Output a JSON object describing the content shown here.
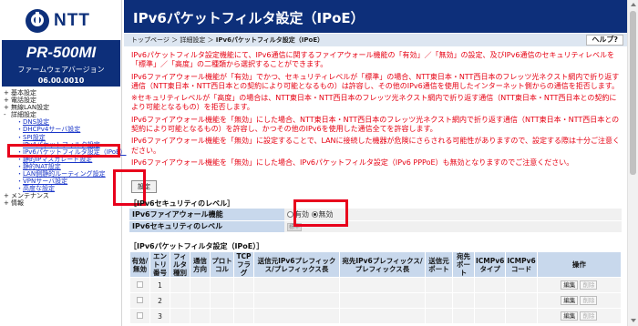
{
  "brand": {
    "logo_text": "NTT",
    "logo_icon": "ntt-globe-icon"
  },
  "model": {
    "name": "PR-500MI",
    "fw_label": "ファームウェアバージョン",
    "fw_version": "06.00.0010"
  },
  "nav": {
    "basic": "基本設定",
    "phone": "電話設定",
    "wlan": "無線LAN設定",
    "detail": "詳細設定",
    "dns": "DNS設定",
    "dhcpv4": "DHCPv4サーバ設定",
    "spi": "SPI設定",
    "ipv4_filter": "IPv4パケットフィルタ設定",
    "ipv6_filter": "IPv6パケットフィルタ設定（IPoE）",
    "static_ip_masq": "静的IPマスカレード設定",
    "static_nat": "静的NAT設定",
    "static_route": "LAN側静的ルーティング設定",
    "vpn": "VPNサーバ設定",
    "advanced": "高度な設定",
    "maintenance": "メンテナンス",
    "info": "情報"
  },
  "page": {
    "title": "IPv6パケットフィルタ設定（IPoE）",
    "crumb_top": "トップページ",
    "crumb_sep1": " ＞ ",
    "crumb_detail": "詳細設定",
    "crumb_sep2": " ＞ ",
    "crumb_current": "IPv6パケットフィルタ設定（IPoE）",
    "help": "ヘルプ?"
  },
  "description": [
    "IPv6パケットフィルタ設定機能にて、IPv6通信に関するファイアウォール機能の「有効」／「無効」の設定、及びIPv6通信のセキュリティレベルを「標準」／「高度」の二種類から選択することができます。",
    "IPv6ファイアウォール機能が「有効」でかつ、セキュリティレベルが「標準」の場合、NTT東日本・NTT西日本のフレッツ光ネクスト網内で折り返す通信（NTT東日本・NTT西日本との契約により可能となるもの）は許容し、その他のIPv6通信を使用したインターネット側からの通信を拒否します。",
    "※セキュリティレベルが「高度」の場合は、NTT東日本・NTT西日本のフレッツ光ネクスト網内で折り返す通信（NTT東日本・NTT西日本との契約により可能となるもの）を拒否します。",
    "IPv6ファイアウォール機能を「無効」にした場合、NTT東日本・NTT西日本のフレッツ光ネクスト網内で折り返す通信（NTT東日本・NTT西日本との契約により可能となるもの）を許容し、かつその他のIPv6を使用した通信全てを許容します。",
    "IPv6ファイアウォール機能を「無効」に設定することで、LANに接続した機器が危険にさらされる可能性がありますので、設定する際は十分ご注意ください。",
    "IPv6ファイアウォール機能を「無効」にした場合、IPv6パケットフィルタ設定（IPv6 PPPoE）も無効となりますのでご注意ください。"
  ],
  "set_button": "設定",
  "security": {
    "section_title": "［IPv6セキュリティのレベル］",
    "fw_label": "IPv6ファイアウォール機能",
    "opt_on": "有効",
    "opt_off": "無効",
    "level_label": "IPv6セキュリティのレベル",
    "level_value": "標準"
  },
  "filter": {
    "section_title": "［IPv6パケットフィルタ設定（IPoE）］",
    "columns": [
      "有効/無効",
      "エントリ番号",
      "フィルタ種別",
      "通信方向",
      "プロトコル",
      "TCPフラグ",
      "送信元IPv6プレフィックス/プレフィックス長",
      "宛先IPv6プレフィックス/プレフィックス長",
      "送信元ポート",
      "宛先ポート",
      "ICMPv6タイプ",
      "ICMPv6コード",
      "操作"
    ],
    "rows": [
      {
        "entry": "1",
        "edit": "編集",
        "delete": "削除"
      },
      {
        "entry": "2",
        "edit": "編集",
        "delete": "削除"
      },
      {
        "entry": "3",
        "edit": "編集",
        "delete": "削除"
      }
    ]
  },
  "colors": {
    "brand_navy": "#0d2f7a",
    "notice_red": "#e60012",
    "highlight_red": "#e8001c",
    "header_blue": "#c8d8ec"
  }
}
